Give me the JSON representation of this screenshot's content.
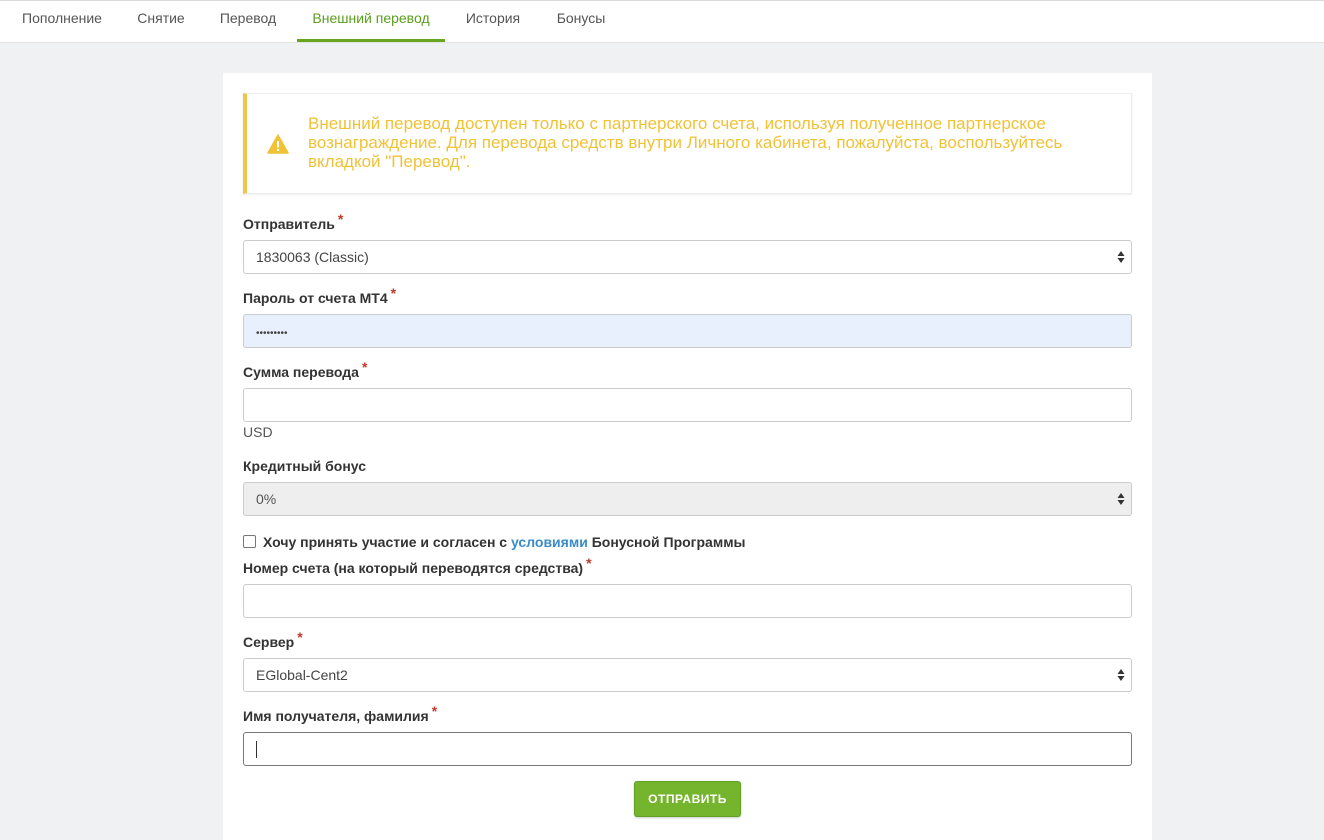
{
  "tabs": [
    {
      "label": "Пополнение"
    },
    {
      "label": "Снятие"
    },
    {
      "label": "Перевод"
    },
    {
      "label": "Внешний перевод",
      "active": true
    },
    {
      "label": "История"
    },
    {
      "label": "Бонусы"
    }
  ],
  "alert": {
    "icon": "warning-icon",
    "text": "Внешний перевод доступен только с партнерского счета, используя полученное партнерское вознаграждение. Для перевода средств внутри Личного кабинета, пожалуйста, воспользуйтесь вкладкой \"Перевод\"."
  },
  "form": {
    "required_mark": "*",
    "sender": {
      "label": "Отправитель",
      "value": "1830063 (Classic)"
    },
    "password": {
      "label": "Пароль от счета MT4",
      "value": "•••••••••"
    },
    "amount": {
      "label": "Сумма перевода",
      "value": "",
      "currency": "USD"
    },
    "credit_bonus": {
      "label": "Кредитный бонус",
      "value": "0%"
    },
    "agree": {
      "checked": false,
      "prefix": "Хочу принять участие и согласен с ",
      "link": "условиями",
      "suffix": " Бонусной Программы"
    },
    "account_number": {
      "label": "Номер счета (на который переводятся средства)",
      "value": ""
    },
    "server": {
      "label": "Сервер",
      "value": "EGlobal-Cent2"
    },
    "recipient": {
      "label": "Имя получателя, фамилия",
      "value": ""
    },
    "submit_label": "ОТПРАВИТЬ"
  },
  "colors": {
    "accent": "#67a51e",
    "warning": "#f0c236",
    "link": "#3a8bc8",
    "required": "#c0392b"
  }
}
